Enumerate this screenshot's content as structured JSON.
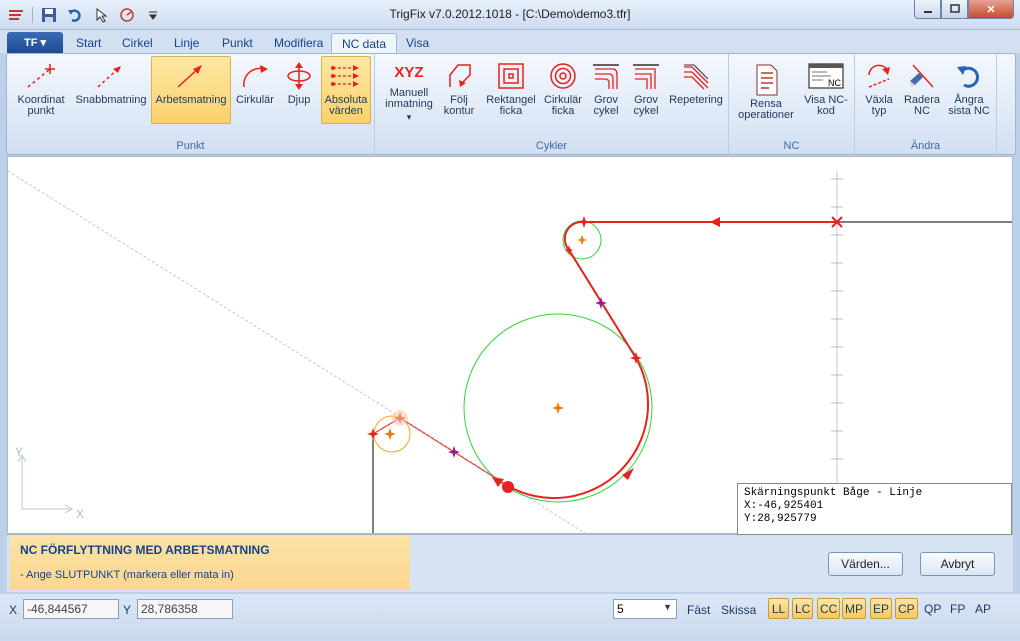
{
  "window": {
    "title": "TrigFix v7.0.2012.1018 - [C:\\Demo\\demo3.tfr]",
    "min_icon": "minimize-icon",
    "max_icon": "maximize-icon",
    "close_label": "✕"
  },
  "app_menu": {
    "label": "TF ▾"
  },
  "tabs": [
    "Start",
    "Cirkel",
    "Linje",
    "Punkt",
    "Modifiera",
    "NC data",
    "Visa"
  ],
  "active_tab": "NC data",
  "ribbon": {
    "groups": [
      {
        "label": "Punkt",
        "buttons": [
          {
            "label": "Koordinat\npunkt",
            "icon": "coordinate-point-icon",
            "selected": false
          },
          {
            "label": "Snabbmatning",
            "icon": "rapid-feed-icon",
            "selected": false
          },
          {
            "label": "Arbetsmatning",
            "icon": "work-feed-icon",
            "selected": true
          },
          {
            "label": "Cirkulär",
            "icon": "circular-icon",
            "selected": false
          },
          {
            "label": "Djup",
            "icon": "depth-icon",
            "selected": false
          },
          {
            "label": "Absoluta\nvärden",
            "icon": "absolute-values-icon",
            "selected": true
          }
        ]
      },
      {
        "label": "Cykler",
        "buttons": [
          {
            "label": "Manuell\ninmatning",
            "icon": "xyz-icon",
            "icon_text": "XYZ",
            "dropdown": "▾"
          },
          {
            "label": "Följ\nkontur",
            "icon": "follow-contour-icon"
          },
          {
            "label": "Rektangel\nficka",
            "icon": "rect-pocket-icon"
          },
          {
            "label": "Cirkulär\nficka",
            "icon": "circular-pocket-icon"
          },
          {
            "label": "Grov\ncykel",
            "icon": "rough-cycle-icon"
          },
          {
            "label": "Grov\ncykel",
            "icon": "rough-cycle-2-icon"
          },
          {
            "label": "Repetering",
            "icon": "repeat-icon"
          }
        ]
      },
      {
        "label": "NC",
        "buttons": [
          {
            "label": "Rensa\noperationer",
            "icon": "clear-operations-icon"
          },
          {
            "label": "Visa NC-\nkod",
            "icon": "show-nc-code-icon",
            "icon_text": "NC"
          }
        ]
      },
      {
        "label": "Ändra",
        "buttons": [
          {
            "label": "Växla\ntyp",
            "icon": "toggle-type-icon"
          },
          {
            "label": "Radera\nNC",
            "icon": "delete-nc-icon"
          },
          {
            "label": "Ångra\nsista NC",
            "icon": "undo-last-nc-icon"
          }
        ]
      }
    ]
  },
  "canvas": {
    "axis_y_label": "Y",
    "axis_x_label": "X"
  },
  "infobox": {
    "title": "Skärningspunkt Båge - Linje",
    "x_line": "X:-46,925401",
    "y_line": "Y:28,925779"
  },
  "prompt": {
    "title": "NC FÖRFLYTTNING MED ARBETSMATNING",
    "subtitle": "- Ange SLUTPUNKT (markera eller mata in)",
    "values_button": "Värden...",
    "cancel_button": "Avbryt"
  },
  "statusbar": {
    "x_label": "X",
    "x_value": "-46,844567",
    "y_label": "Y",
    "y_value": "28,786358",
    "grid_value": "5",
    "fast_label": "Fäst",
    "sketch_label": "Skissa",
    "snaps": [
      {
        "label": "LL",
        "on": true
      },
      {
        "label": "LC",
        "on": true
      },
      {
        "label": "CC",
        "on": true
      },
      {
        "label": "MP",
        "on": true
      },
      {
        "label": "EP",
        "on": true
      },
      {
        "label": "CP",
        "on": true
      },
      {
        "label": "QP",
        "on": false
      },
      {
        "label": "FP",
        "on": false
      },
      {
        "label": "AP",
        "on": false
      }
    ]
  },
  "colors": {
    "toolpath": "#e8201e",
    "circle": "#34d33a",
    "center_marker": "#f07800",
    "accent_selected": "#fbd26a"
  }
}
